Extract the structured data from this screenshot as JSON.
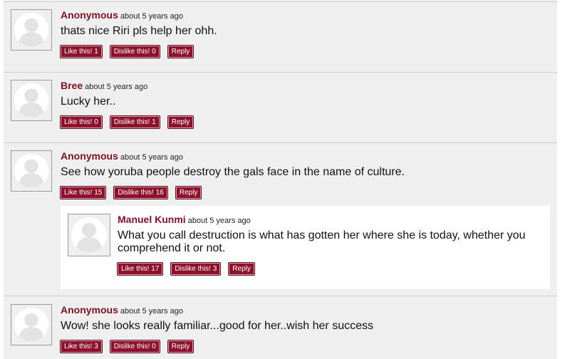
{
  "comments": [
    {
      "author": "Anonymous",
      "time": "about 5 years ago",
      "text": "thats nice Riri pls help her ohh.",
      "like": "Like this! 1",
      "dislike": "Dislike this! 0",
      "reply": "Reply"
    },
    {
      "author": "Bree",
      "time": "about 5 years ago",
      "text": "Lucky her..",
      "like": "Like this! 0",
      "dislike": "Dislike this! 1",
      "reply": "Reply"
    },
    {
      "author": "Anonymous",
      "time": "about 5 years ago",
      "text": "See how yoruba people destroy the gals face in the name of culture.",
      "like": "Like this! 15",
      "dislike": "Dislike this! 16",
      "reply": "Reply"
    },
    {
      "author": "Manuel Kunmi",
      "time": "about 5 years ago",
      "text": "What you call destruction is what has gotten her where she is today, whether you comprehend it or not.",
      "like": "Like this! 17",
      "dislike": "Dislike this! 3",
      "reply": "Reply"
    },
    {
      "author": "Anonymous",
      "time": "about 5 years ago",
      "text": "Wow! she looks really familiar...good for her..wish her success",
      "like": "Like this! 3",
      "dislike": "Dislike this! 0",
      "reply": "Reply"
    }
  ],
  "colors": {
    "author": "#7c1025",
    "button": "#8e0f2b",
    "panel": "#efefef"
  }
}
